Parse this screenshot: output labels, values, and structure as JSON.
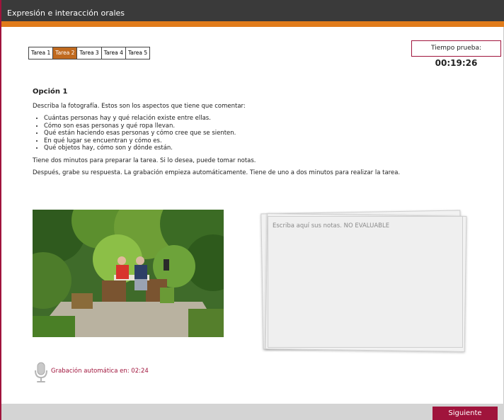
{
  "window": {
    "title": "Expresión e interacción orales"
  },
  "tabs": [
    {
      "label": "Tarea 1",
      "active": false
    },
    {
      "label": "Tarea 2",
      "active": true
    },
    {
      "label": "Tarea 3",
      "active": false
    },
    {
      "label": "Tarea 4",
      "active": false
    },
    {
      "label": "Tarea 5",
      "active": false
    }
  ],
  "timer": {
    "label": "Tiempo prueba:",
    "value": "00:19:26"
  },
  "task": {
    "title": "Opción 1",
    "intro": "Describa la fotografía. Estos son los aspectos que tiene que comentar:",
    "bullets": [
      "Cuántas personas hay y qué relación existe entre ellas.",
      "Cómo son esas personas y qué ropa llevan.",
      "Qué están haciendo esas personas y cómo cree que se sienten.",
      "En qué lugar se encuentran y cómo es.",
      "Qué objetos hay, cómo son y dónde están."
    ],
    "prep_text": "Tiene dos minutos para preparar la tarea. Si lo desea, puede tomar notas.",
    "record_text": "Después, grabe su respuesta. La grabación empieza automáticamente. Tiene de uno a dos minutos para realizar la tarea."
  },
  "notes": {
    "placeholder": "Escriba aquí sus notas. NO EVALUABLE",
    "value": ""
  },
  "recording": {
    "label": "Grabación automática en: 02:24"
  },
  "footer": {
    "next_label": "Siguiente"
  },
  "colors": {
    "accent": "#a0143c",
    "orange": "#e07b1a",
    "titlebar": "#3a3a3a"
  },
  "icons": {
    "mic": "microphone-icon"
  }
}
